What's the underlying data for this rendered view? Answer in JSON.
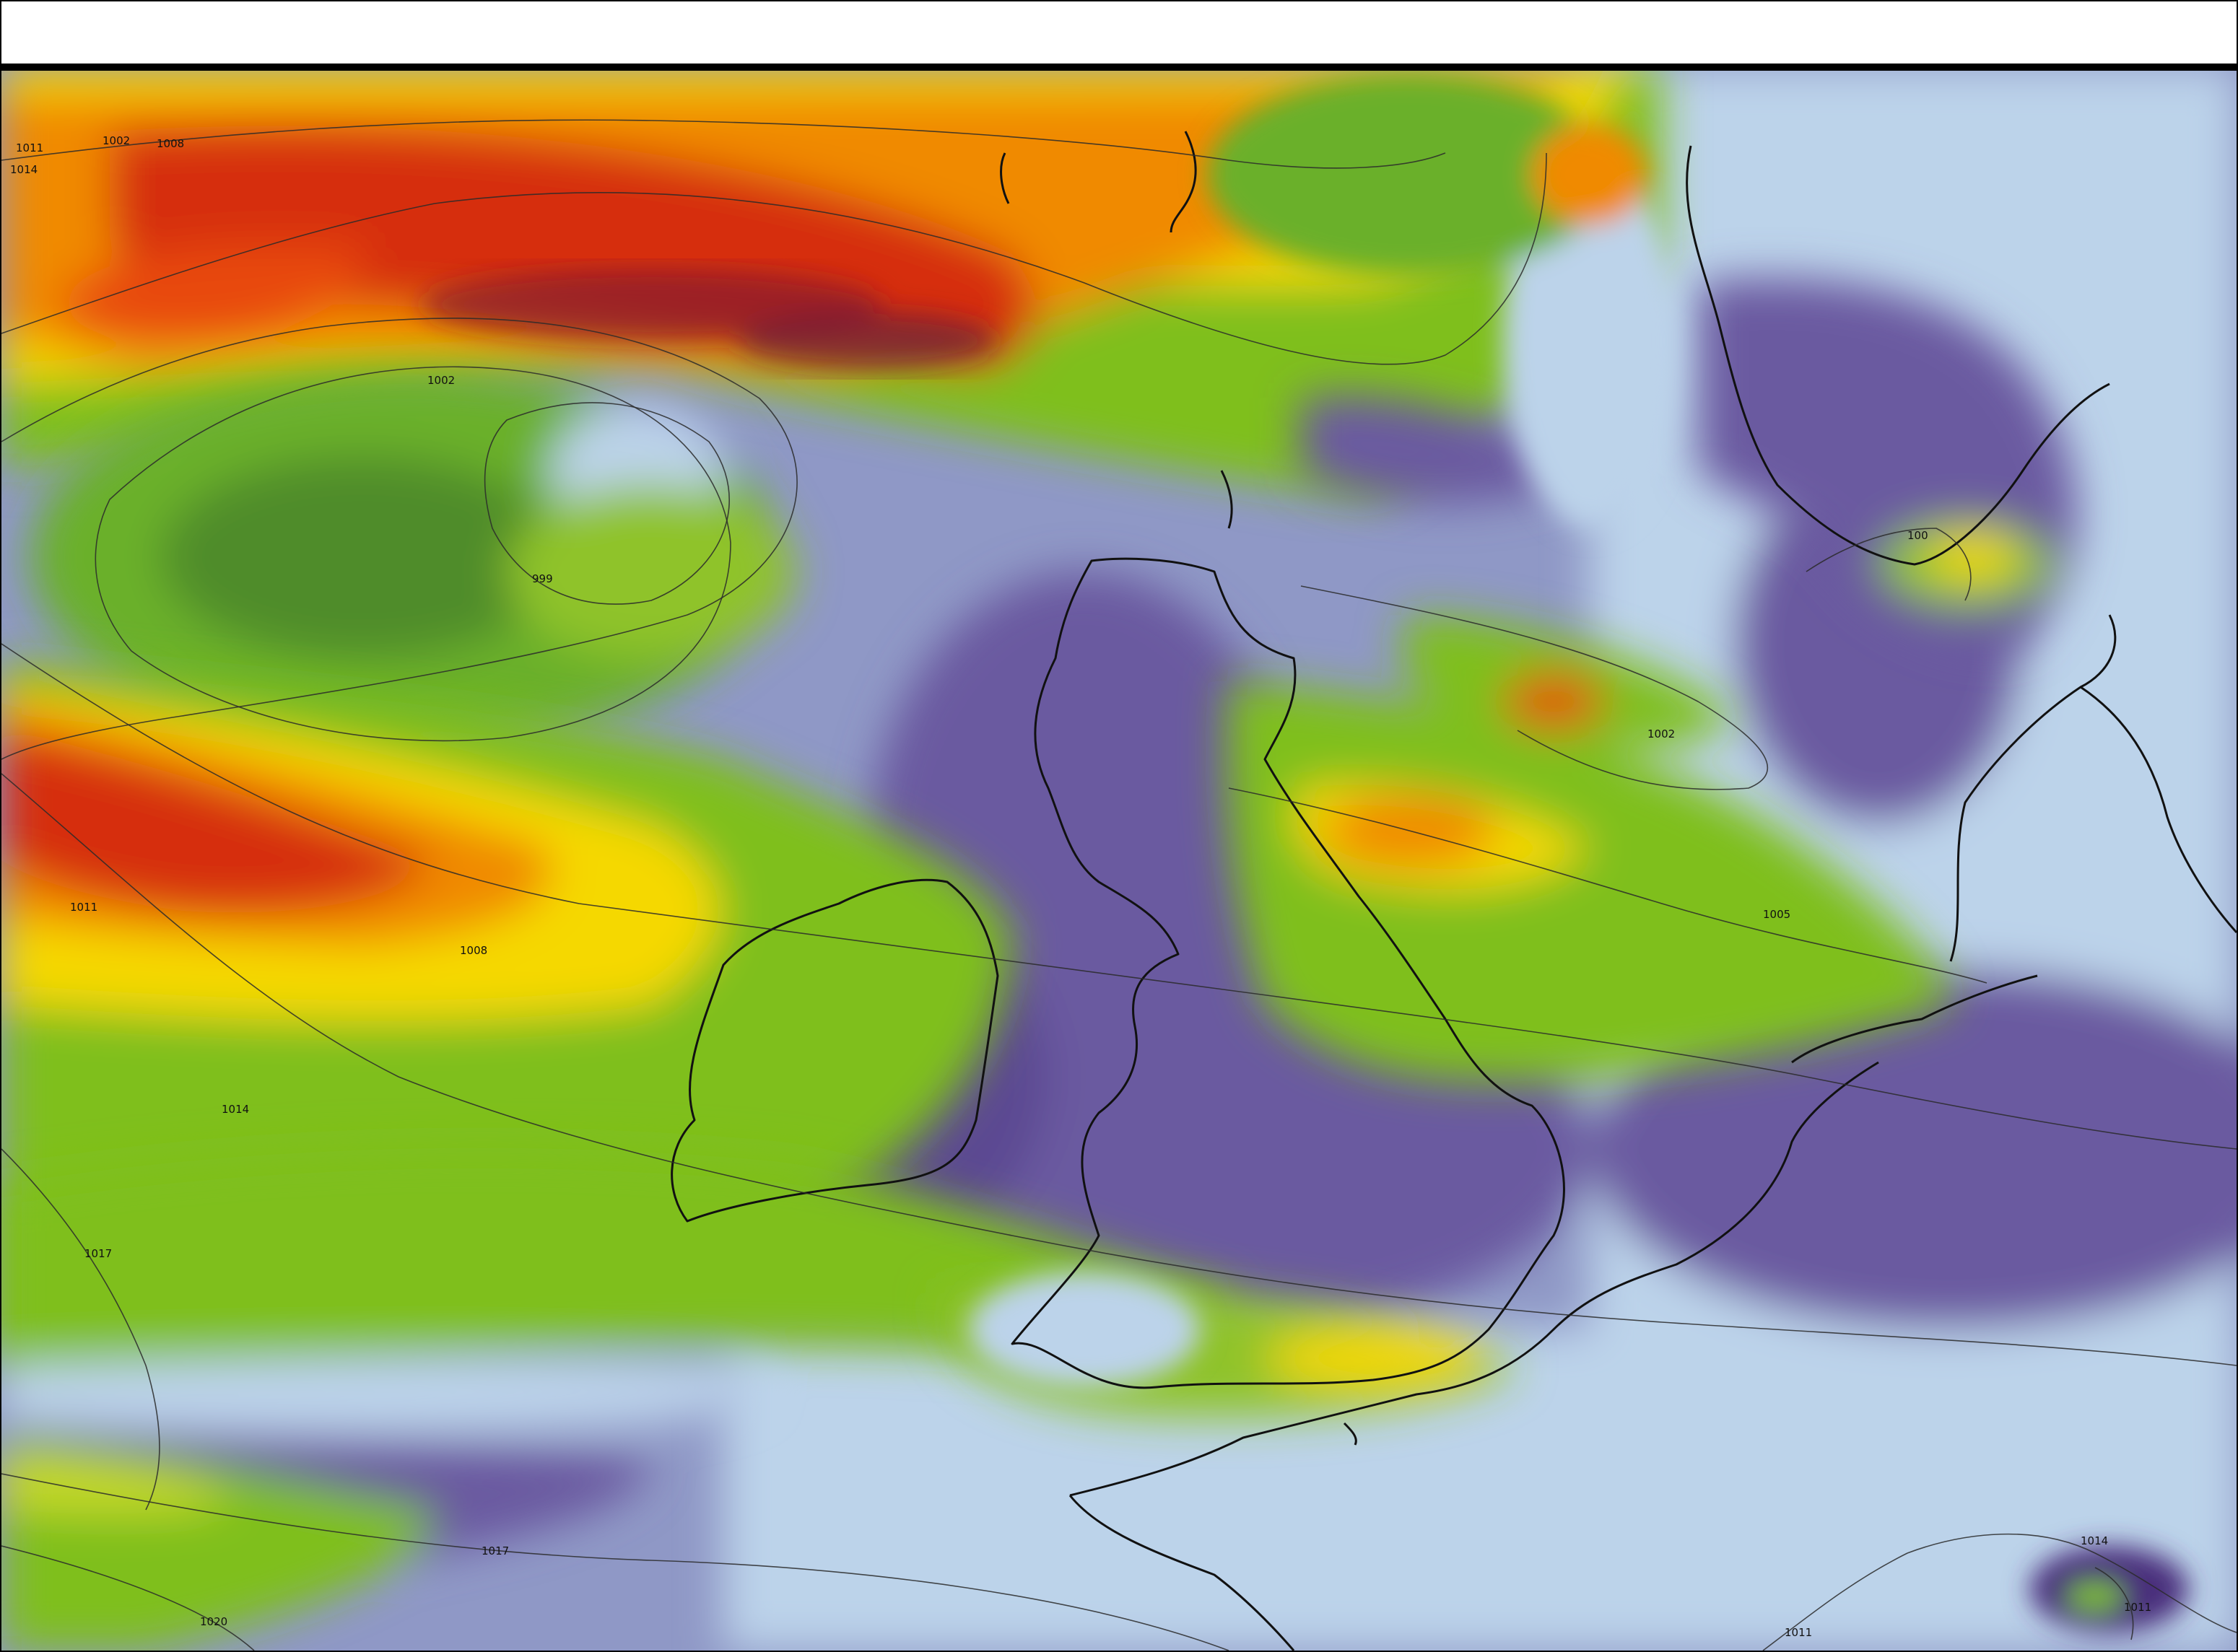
{
  "map": {
    "field_colors": {
      "calm": "#bcd3ea",
      "low": "#4a2f7c",
      "mid_low": "#5c8a2a",
      "mid": "#7fbf1f",
      "mid_high": "#f5d800",
      "high": "#f08a00",
      "peak": "#d62d0c",
      "extreme": "#5a1a4a"
    },
    "isobar_labels": [
      {
        "id": "p-1014-a",
        "text": "1014"
      },
      {
        "id": "p-1011-a",
        "text": "1011"
      },
      {
        "id": "p-1002-a",
        "text": "1002"
      },
      {
        "id": "p-1008-top",
        "text": "1008"
      },
      {
        "id": "p-1002-b",
        "text": "1002"
      },
      {
        "id": "p-999",
        "text": "999"
      },
      {
        "id": "p-1011-b",
        "text": "1011"
      },
      {
        "id": "p-1008-b",
        "text": "1008"
      },
      {
        "id": "p-1014-b",
        "text": "1014"
      },
      {
        "id": "p-1017-a",
        "text": "1017"
      },
      {
        "id": "p-1017-b",
        "text": "1017"
      },
      {
        "id": "p-1020",
        "text": "1020"
      },
      {
        "id": "p-1002-c",
        "text": "1002"
      },
      {
        "id": "p-1005",
        "text": "1005"
      },
      {
        "id": "p-100",
        "text": "100"
      },
      {
        "id": "p-1014-c",
        "text": "1014"
      },
      {
        "id": "p-1011-c",
        "text": "1011"
      },
      {
        "id": "p-1011-d",
        "text": "1011"
      }
    ]
  }
}
